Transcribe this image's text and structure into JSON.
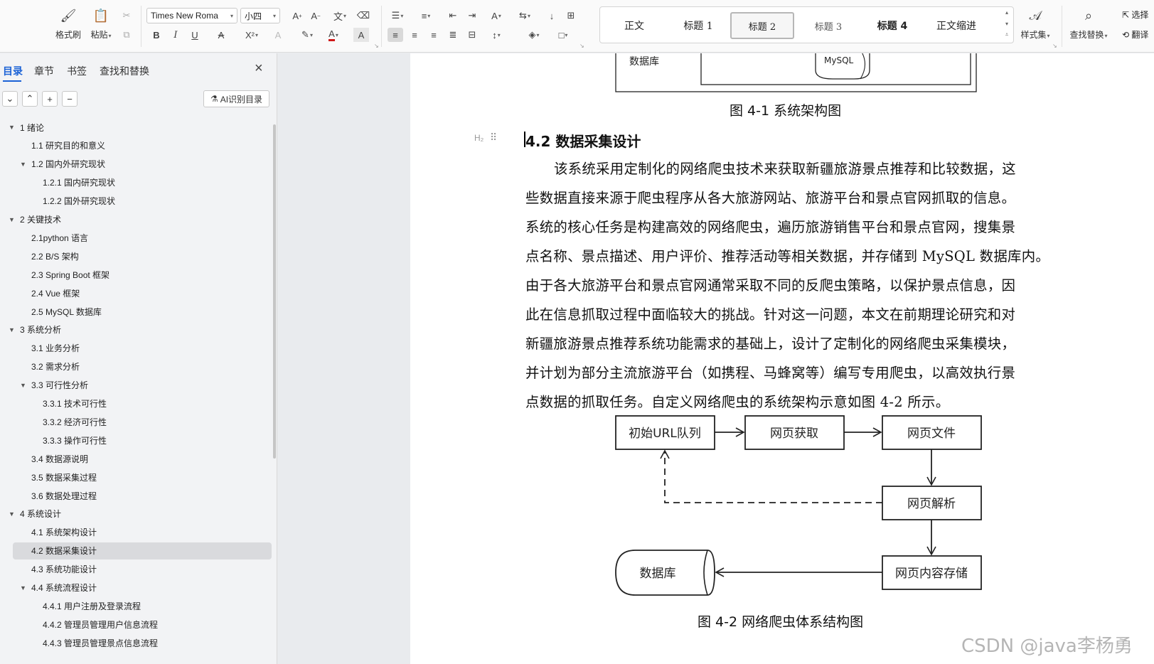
{
  "ribbon": {
    "format_painter": "格式刷",
    "paste": "粘贴",
    "font_name": "Times New Roma",
    "font_size": "小四",
    "bold": "B",
    "italic": "I",
    "underline": "U",
    "superscript": "X²",
    "styles": [
      "正文",
      "标题 1",
      "标题 2",
      "标题 3",
      "标题 4",
      "正文缩进"
    ],
    "active_style_index": 2,
    "style_set": "样式集",
    "find_replace": "查找替换",
    "select": "选择",
    "translate": "翻译"
  },
  "panel": {
    "tabs": [
      "目录",
      "章节",
      "书签",
      "查找和替换"
    ],
    "active_tab": 0,
    "ai_button": "AI识别目录",
    "toc": [
      {
        "label": "1  绪论",
        "level": 0,
        "expanded": true
      },
      {
        "label": "1.1  研究目的和意义",
        "level": 1
      },
      {
        "label": "1.2  国内外研究现状",
        "level": 1,
        "expanded": true
      },
      {
        "label": "1.2.1  国内研究现状",
        "level": 2
      },
      {
        "label": "1.2.2  国外研究现状",
        "level": 2
      },
      {
        "label": "2 关键技术",
        "level": 0,
        "expanded": true
      },
      {
        "label": "2.1python 语言",
        "level": 1
      },
      {
        "label": "2.2 B/S 架构",
        "level": 1
      },
      {
        "label": "2.3 Spring Boot 框架",
        "level": 1
      },
      {
        "label": "2.4 Vue 框架",
        "level": 1
      },
      {
        "label": "2.5 MySQL 数据库",
        "level": 1
      },
      {
        "label": "3  系统分析",
        "level": 0,
        "expanded": true
      },
      {
        "label": "3.1 业务分析",
        "level": 1
      },
      {
        "label": "3.2  需求分析",
        "level": 1
      },
      {
        "label": "3.3  可行性分析",
        "level": 1,
        "expanded": true
      },
      {
        "label": "3.3.1  技术可行性",
        "level": 2
      },
      {
        "label": "3.3.2  经济可行性",
        "level": 2
      },
      {
        "label": "3.3.3  操作可行性",
        "level": 2
      },
      {
        "label": "3.4 数据源说明",
        "level": 1
      },
      {
        "label": "3.5 数据采集过程",
        "level": 1
      },
      {
        "label": "3.6 数据处理过程",
        "level": 1
      },
      {
        "label": "4 系统设计",
        "level": 0,
        "expanded": true
      },
      {
        "label": "4.1  系统架构设计",
        "level": 1
      },
      {
        "label": "4.2 数据采集设计",
        "level": 1,
        "selected": true
      },
      {
        "label": "4.3  系统功能设计",
        "level": 1
      },
      {
        "label": "4.4  系统流程设计",
        "level": 1,
        "expanded": true
      },
      {
        "label": "4.4.1  用户注册及登录流程",
        "level": 2
      },
      {
        "label": "4.4.2  管理员管理用户信息流程",
        "level": 2
      },
      {
        "label": "4.4.3  管理员管理景点信息流程",
        "level": 2
      }
    ]
  },
  "document": {
    "fig1_db_label": "数据库",
    "fig1_mysql": "MySQL",
    "fig1_caption": "图 4-1    系统架构图",
    "h2_marker": "H₂",
    "heading": "4.2 数据采集设计",
    "paragraph_lines": [
      "该系统采用定制化的网络爬虫技术来获取新疆旅游景点推荐和比较数据，这",
      "些数据直接来源于爬虫程序从各大旅游网站、旅游平台和景点官网抓取的信息。",
      "系统的核心任务是构建高效的网络爬虫，遍历旅游销售平台和景点官网，搜集景",
      "点名称、景点描述、用户评价、推荐活动等相关数据，并存储到 MySQL 数据库内。",
      "由于各大旅游平台和景点官网通常采取不同的反爬虫策略，以保护景点信息，因",
      "此在信息抓取过程中面临较大的挑战。针对这一问题，本文在前期理论研究和对",
      "新疆旅游景点推荐系统功能需求的基础上，设计了定制化的网络爬虫采集模块，",
      "并计划为部分主流旅游平台（如携程、马蜂窝等）编写专用爬虫，以高效执行景",
      "点数据的抓取任务。自定义网络爬虫的系统架构示意如图 4-2 所示。"
    ],
    "fig2": {
      "nodes": {
        "seed": "初始URL队列",
        "fetch": "网页获取",
        "file": "网页文件",
        "parse": "网页解析",
        "store": "网页内容存储",
        "db": "数据库"
      },
      "caption": "图  4-2    网络爬虫体系结构图"
    }
  },
  "watermark": "CSDN @java李杨勇"
}
